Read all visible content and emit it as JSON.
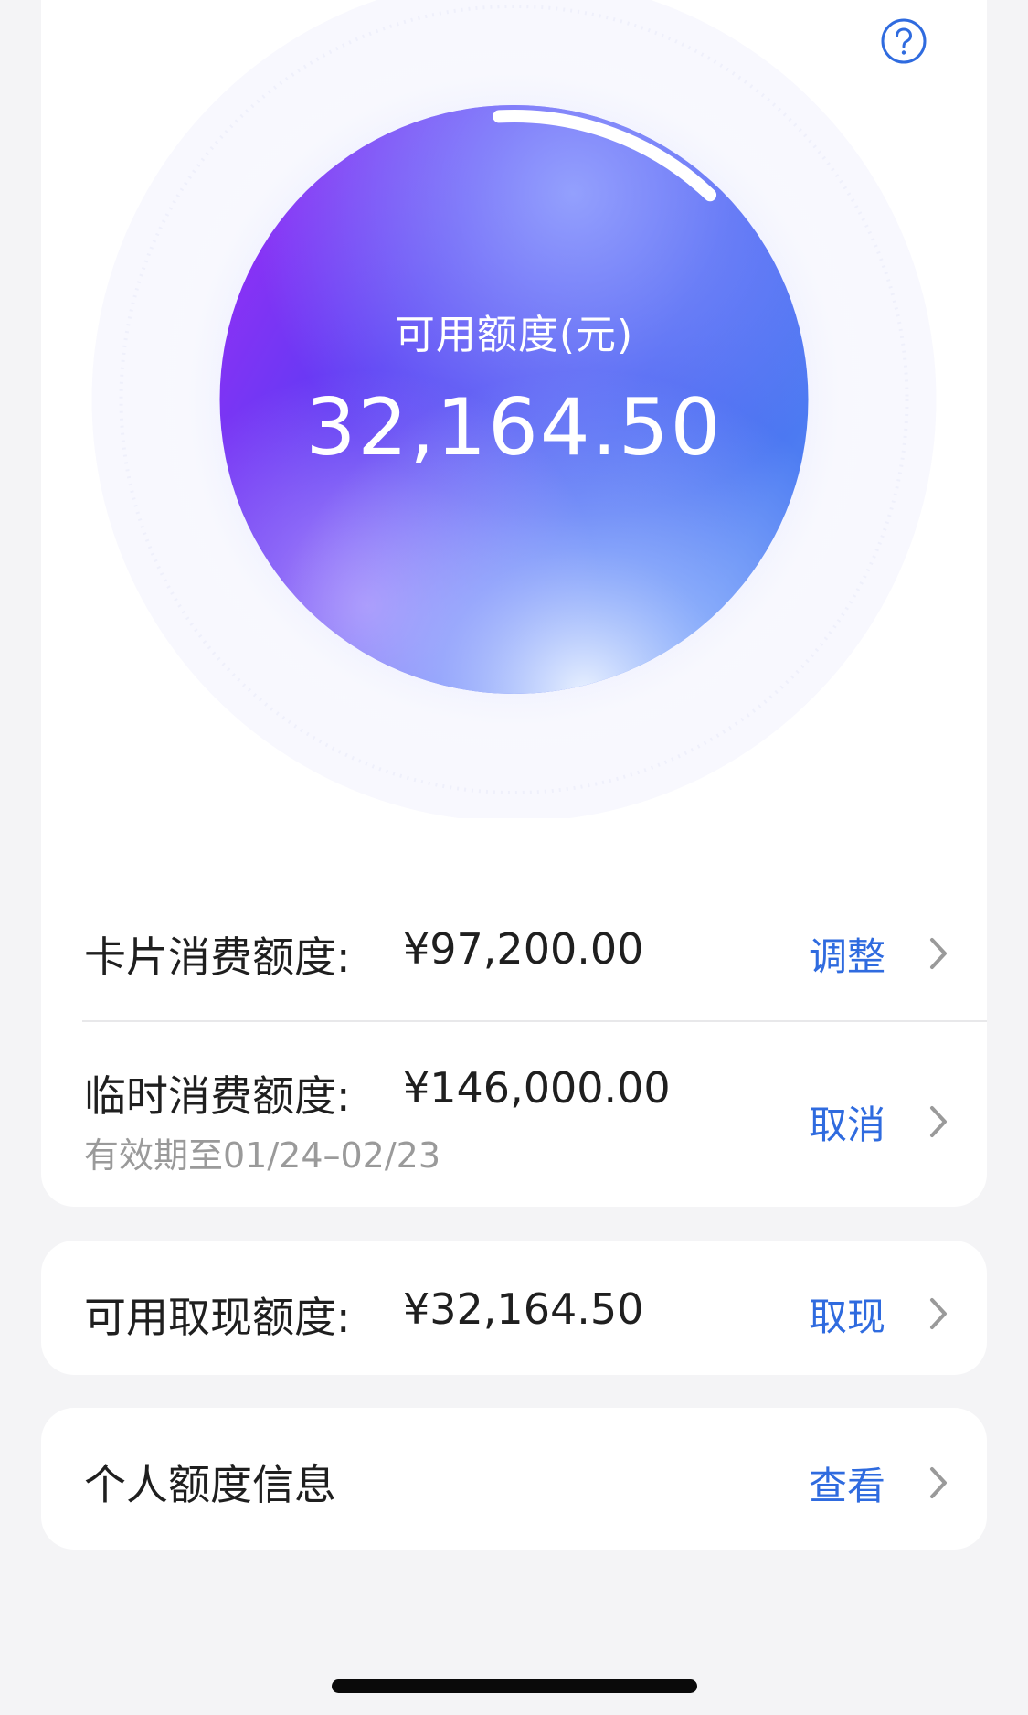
{
  "balance": {
    "label": "可用额度(元)",
    "amount": "32,164.50",
    "arc_fraction": 0.13
  },
  "rows": {
    "card_limit": {
      "label": "卡片消费额度:",
      "value": "¥97,200.00",
      "action": "调整"
    },
    "temp_limit": {
      "label": "临时消费额度:",
      "value": "¥146,000.00",
      "validity": "有效期至01/24–02/23",
      "action": "取消"
    },
    "cash_limit": {
      "label": "可用取现额度:",
      "value": "¥32,164.50",
      "action": "取现"
    },
    "personal_info": {
      "label": "个人额度信息",
      "action": "查看"
    }
  },
  "icons": {
    "help": "question-circle-icon",
    "chevron": "chevron-right-icon"
  },
  "colors": {
    "accent": "#2f6bdf",
    "background": "#f4f4f6",
    "card": "#ffffff",
    "circle_purple": "#9b2cf5",
    "circle_blue": "#3d52f0"
  }
}
